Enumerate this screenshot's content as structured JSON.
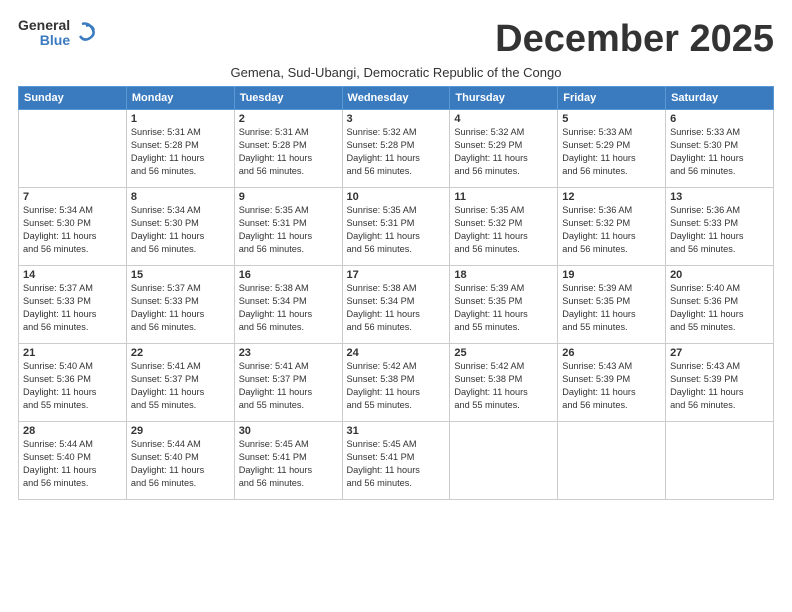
{
  "logo": {
    "general": "General",
    "blue": "Blue",
    "tagline": ""
  },
  "header": {
    "month_title": "December 2025",
    "subtitle": "Gemena, Sud-Ubangi, Democratic Republic of the Congo"
  },
  "calendar": {
    "days_of_week": [
      "Sunday",
      "Monday",
      "Tuesday",
      "Wednesday",
      "Thursday",
      "Friday",
      "Saturday"
    ],
    "weeks": [
      [
        {
          "day": "",
          "info": ""
        },
        {
          "day": "1",
          "info": "Sunrise: 5:31 AM\nSunset: 5:28 PM\nDaylight: 11 hours\nand 56 minutes."
        },
        {
          "day": "2",
          "info": "Sunrise: 5:31 AM\nSunset: 5:28 PM\nDaylight: 11 hours\nand 56 minutes."
        },
        {
          "day": "3",
          "info": "Sunrise: 5:32 AM\nSunset: 5:28 PM\nDaylight: 11 hours\nand 56 minutes."
        },
        {
          "day": "4",
          "info": "Sunrise: 5:32 AM\nSunset: 5:29 PM\nDaylight: 11 hours\nand 56 minutes."
        },
        {
          "day": "5",
          "info": "Sunrise: 5:33 AM\nSunset: 5:29 PM\nDaylight: 11 hours\nand 56 minutes."
        },
        {
          "day": "6",
          "info": "Sunrise: 5:33 AM\nSunset: 5:30 PM\nDaylight: 11 hours\nand 56 minutes."
        }
      ],
      [
        {
          "day": "7",
          "info": "Sunrise: 5:34 AM\nSunset: 5:30 PM\nDaylight: 11 hours\nand 56 minutes."
        },
        {
          "day": "8",
          "info": "Sunrise: 5:34 AM\nSunset: 5:30 PM\nDaylight: 11 hours\nand 56 minutes."
        },
        {
          "day": "9",
          "info": "Sunrise: 5:35 AM\nSunset: 5:31 PM\nDaylight: 11 hours\nand 56 minutes."
        },
        {
          "day": "10",
          "info": "Sunrise: 5:35 AM\nSunset: 5:31 PM\nDaylight: 11 hours\nand 56 minutes."
        },
        {
          "day": "11",
          "info": "Sunrise: 5:35 AM\nSunset: 5:32 PM\nDaylight: 11 hours\nand 56 minutes."
        },
        {
          "day": "12",
          "info": "Sunrise: 5:36 AM\nSunset: 5:32 PM\nDaylight: 11 hours\nand 56 minutes."
        },
        {
          "day": "13",
          "info": "Sunrise: 5:36 AM\nSunset: 5:33 PM\nDaylight: 11 hours\nand 56 minutes."
        }
      ],
      [
        {
          "day": "14",
          "info": "Sunrise: 5:37 AM\nSunset: 5:33 PM\nDaylight: 11 hours\nand 56 minutes."
        },
        {
          "day": "15",
          "info": "Sunrise: 5:37 AM\nSunset: 5:33 PM\nDaylight: 11 hours\nand 56 minutes."
        },
        {
          "day": "16",
          "info": "Sunrise: 5:38 AM\nSunset: 5:34 PM\nDaylight: 11 hours\nand 56 minutes."
        },
        {
          "day": "17",
          "info": "Sunrise: 5:38 AM\nSunset: 5:34 PM\nDaylight: 11 hours\nand 56 minutes."
        },
        {
          "day": "18",
          "info": "Sunrise: 5:39 AM\nSunset: 5:35 PM\nDaylight: 11 hours\nand 55 minutes."
        },
        {
          "day": "19",
          "info": "Sunrise: 5:39 AM\nSunset: 5:35 PM\nDaylight: 11 hours\nand 55 minutes."
        },
        {
          "day": "20",
          "info": "Sunrise: 5:40 AM\nSunset: 5:36 PM\nDaylight: 11 hours\nand 55 minutes."
        }
      ],
      [
        {
          "day": "21",
          "info": "Sunrise: 5:40 AM\nSunset: 5:36 PM\nDaylight: 11 hours\nand 55 minutes."
        },
        {
          "day": "22",
          "info": "Sunrise: 5:41 AM\nSunset: 5:37 PM\nDaylight: 11 hours\nand 55 minutes."
        },
        {
          "day": "23",
          "info": "Sunrise: 5:41 AM\nSunset: 5:37 PM\nDaylight: 11 hours\nand 55 minutes."
        },
        {
          "day": "24",
          "info": "Sunrise: 5:42 AM\nSunset: 5:38 PM\nDaylight: 11 hours\nand 55 minutes."
        },
        {
          "day": "25",
          "info": "Sunrise: 5:42 AM\nSunset: 5:38 PM\nDaylight: 11 hours\nand 55 minutes."
        },
        {
          "day": "26",
          "info": "Sunrise: 5:43 AM\nSunset: 5:39 PM\nDaylight: 11 hours\nand 56 minutes."
        },
        {
          "day": "27",
          "info": "Sunrise: 5:43 AM\nSunset: 5:39 PM\nDaylight: 11 hours\nand 56 minutes."
        }
      ],
      [
        {
          "day": "28",
          "info": "Sunrise: 5:44 AM\nSunset: 5:40 PM\nDaylight: 11 hours\nand 56 minutes."
        },
        {
          "day": "29",
          "info": "Sunrise: 5:44 AM\nSunset: 5:40 PM\nDaylight: 11 hours\nand 56 minutes."
        },
        {
          "day": "30",
          "info": "Sunrise: 5:45 AM\nSunset: 5:41 PM\nDaylight: 11 hours\nand 56 minutes."
        },
        {
          "day": "31",
          "info": "Sunrise: 5:45 AM\nSunset: 5:41 PM\nDaylight: 11 hours\nand 56 minutes."
        },
        {
          "day": "",
          "info": ""
        },
        {
          "day": "",
          "info": ""
        },
        {
          "day": "",
          "info": ""
        }
      ]
    ]
  }
}
